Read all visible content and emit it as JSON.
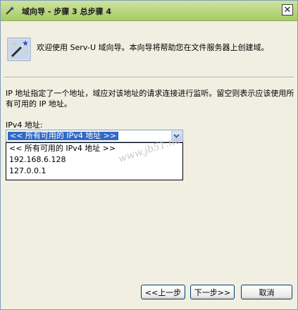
{
  "window": {
    "title": "域向导 - 步骤 3 总步骤 4",
    "close_glyph": "✕"
  },
  "header": {
    "text": "欢迎使用 Serv-U 域向导。本向导将帮助您在文件服务器上创建域。"
  },
  "description": "IP 地址指定了一个地址，域应对该地址的请求连接进行监听。留空则表示应该使用所有可用的 IP 地址。",
  "ipv4": {
    "label": "IPv4 地址:",
    "selected": "<< 所有可用的 IPv4 地址 >>",
    "options": [
      "<< 所有可用的 IPv4 地址 >>",
      "192.168.6.128",
      "127.0.0.1"
    ]
  },
  "watermark": "www.jb51.net",
  "buttons": {
    "back": "<<上一步",
    "next": "下一步>>",
    "cancel": "取消"
  }
}
